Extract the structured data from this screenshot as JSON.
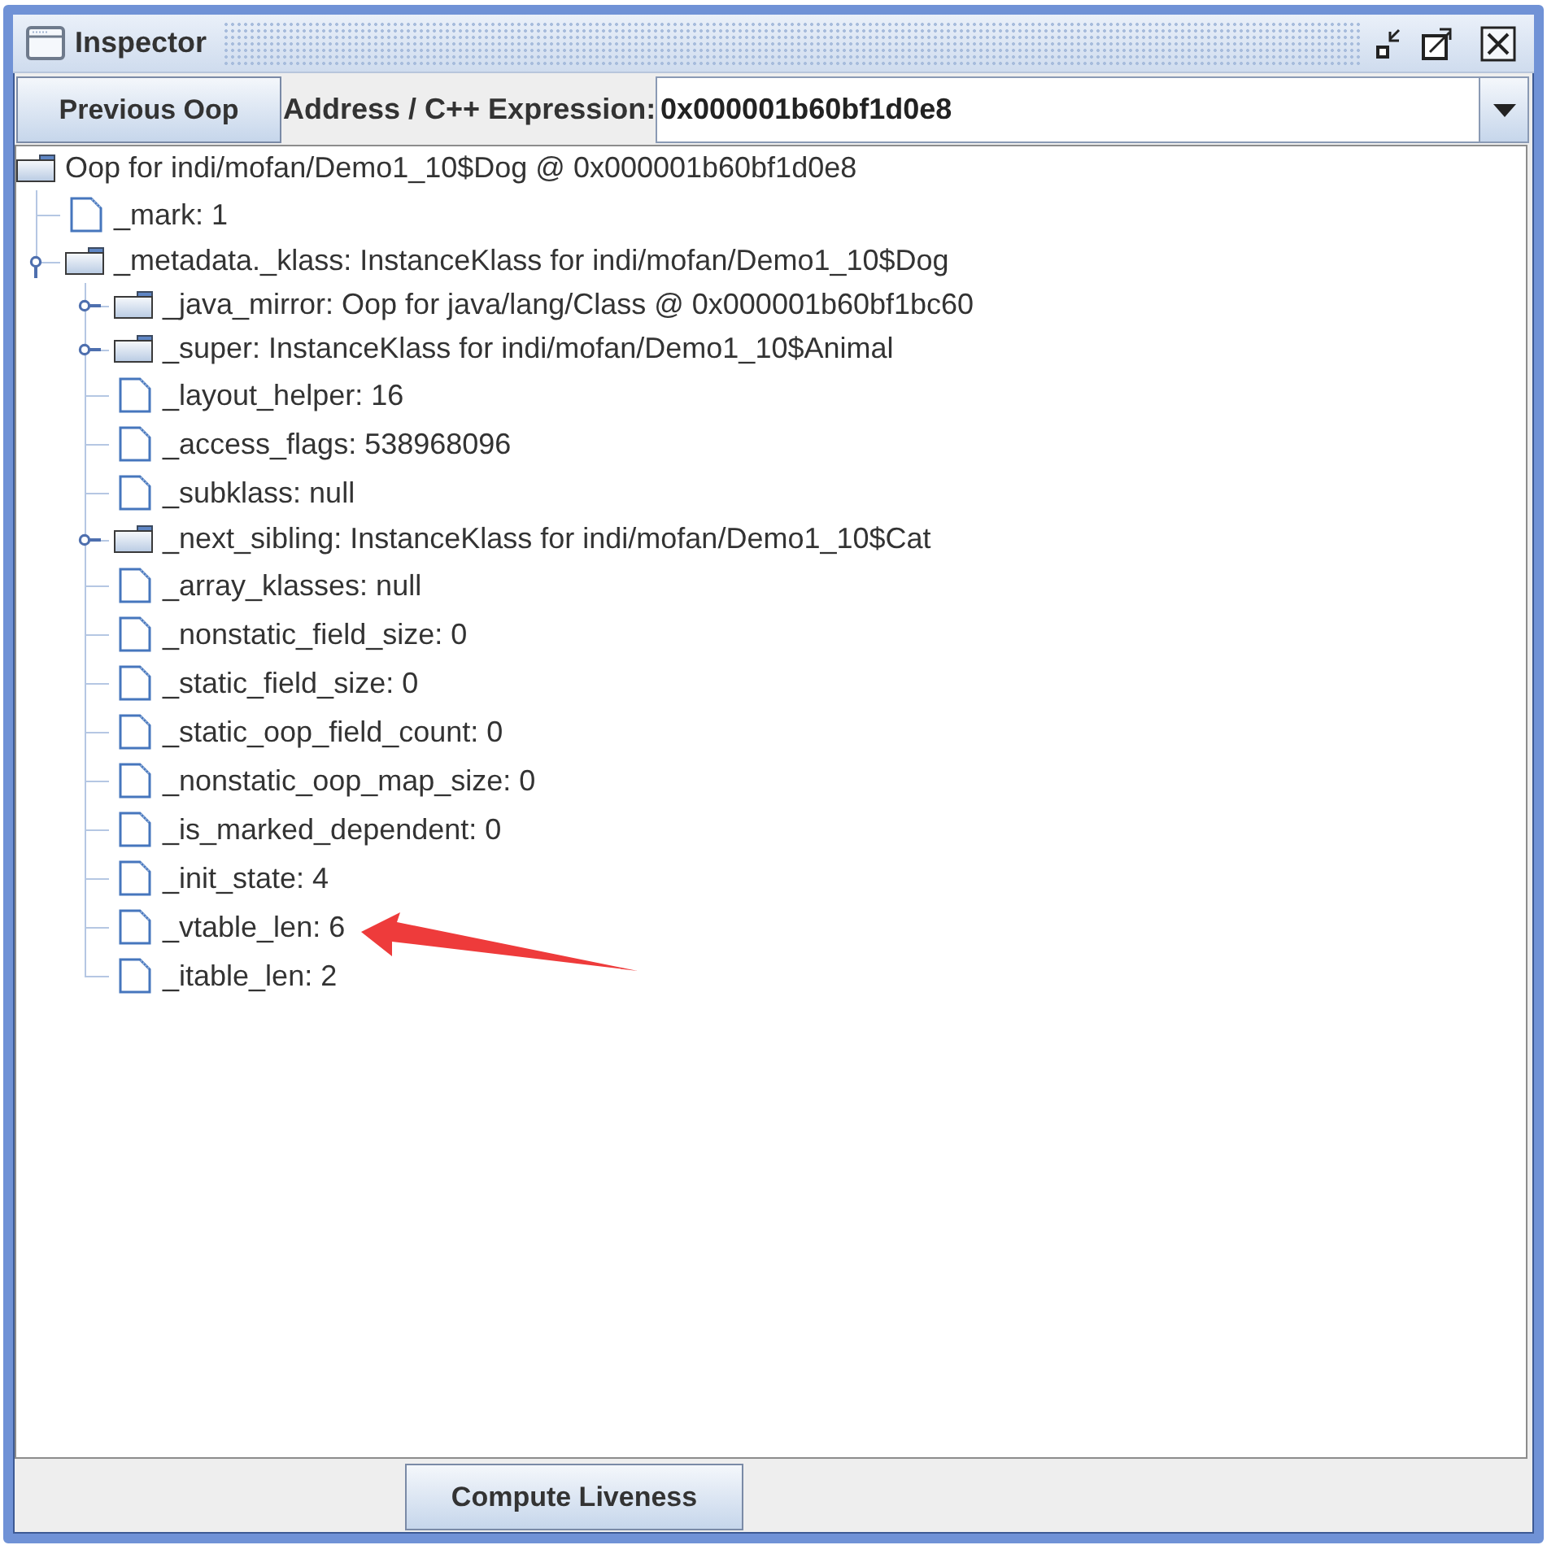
{
  "window": {
    "title": "Inspector"
  },
  "toolbar": {
    "button": "Previous Oop",
    "address_label": "Address / C++ Expression:",
    "address_value": "0x000001b60bf1d0e8"
  },
  "tree": {
    "root": {
      "kind": "folder",
      "label": "Oop for indi/mofan/Demo1_10$Dog @ 0x000001b60bf1d0e8",
      "children": [
        {
          "kind": "leaf",
          "label": "_mark: 1"
        },
        {
          "kind": "folder",
          "label": "_metadata._klass: InstanceKlass for indi/mofan/Demo1_10$Dog",
          "expanded": true,
          "children": [
            {
              "kind": "folder",
              "label": "_java_mirror: Oop for java/lang/Class @ 0x000001b60bf1bc60",
              "expanded": false
            },
            {
              "kind": "folder",
              "label": "_super: InstanceKlass for indi/mofan/Demo1_10$Animal",
              "expanded": false
            },
            {
              "kind": "leaf",
              "label": "_layout_helper: 16"
            },
            {
              "kind": "leaf",
              "label": "_access_flags: 538968096"
            },
            {
              "kind": "leaf",
              "label": "_subklass: null"
            },
            {
              "kind": "folder",
              "label": "_next_sibling: InstanceKlass for indi/mofan/Demo1_10$Cat",
              "expanded": false
            },
            {
              "kind": "leaf",
              "label": "_array_klasses: null"
            },
            {
              "kind": "leaf",
              "label": "_nonstatic_field_size: 0"
            },
            {
              "kind": "leaf",
              "label": "_static_field_size: 0"
            },
            {
              "kind": "leaf",
              "label": "_static_oop_field_count: 0"
            },
            {
              "kind": "leaf",
              "label": "_nonstatic_oop_map_size: 0"
            },
            {
              "kind": "leaf",
              "label": "_is_marked_dependent: 0"
            },
            {
              "kind": "leaf",
              "label": "_init_state: 4"
            },
            {
              "kind": "leaf",
              "label": "_vtable_len: 6"
            },
            {
              "kind": "leaf",
              "label": "_itable_len: 2"
            }
          ]
        }
      ]
    }
  },
  "annotations": [
    {
      "kind": "arrow"
    }
  ],
  "footer": {
    "button": "Compute Liveness"
  }
}
